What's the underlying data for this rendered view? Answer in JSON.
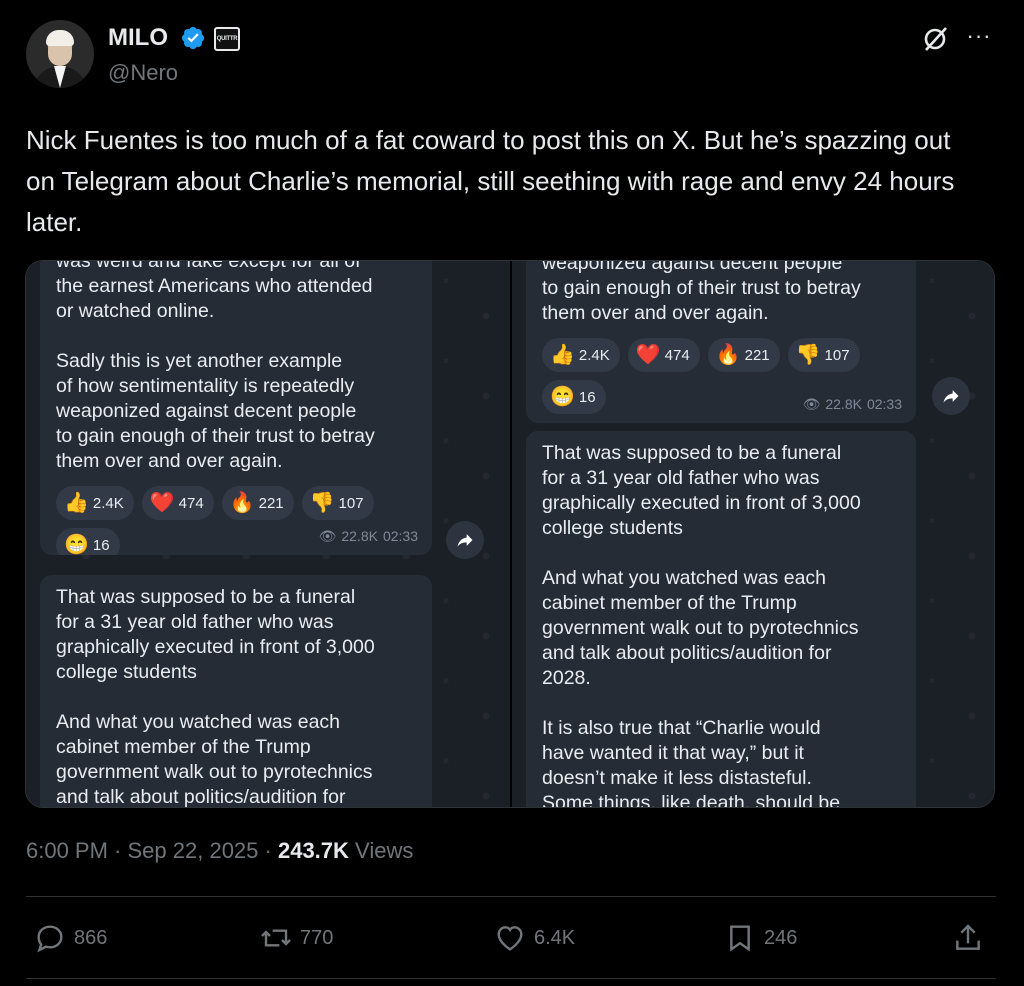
{
  "author": {
    "name": "MILO",
    "handle": "@Nero",
    "affiliate_badge_text": "QUITTR",
    "verified_color": "#1d9bf0"
  },
  "tweet": {
    "text": "Nick Fuentes is too much of a fat coward to post this on X. But he’s spazzing out on Telegram about Charlie’s memorial, still seething with rage and envy 24 hours later."
  },
  "media": {
    "left": {
      "top_text": "was weird and fake except for all of\nthe earnest Americans who attended\nor watched online.\n\nSadly this is yet another example\nof how sentimentality is repeatedly\nweaponized against decent people\nto gain enough of their trust to betray\nthem over and over again.",
      "reactions": [
        {
          "emoji": "👍",
          "count": "2.4K"
        },
        {
          "emoji": "❤️",
          "count": "474"
        },
        {
          "emoji": "🔥",
          "count": "221"
        },
        {
          "emoji": "👎",
          "count": "107"
        },
        {
          "emoji": "😁",
          "count": "16"
        }
      ],
      "views": "22.8K",
      "time": "02:33",
      "bottom_text": "That was supposed to be a funeral\nfor a 31 year old father who was\ngraphically executed in front of 3,000\ncollege students\n\nAnd what you watched was each\ncabinet member of the Trump\ngovernment walk out to pyrotechnics\nand talk about politics/audition for"
    },
    "right": {
      "top_text": "weaponized against decent people\nto gain enough of their trust to betray\nthem over and over again.",
      "reactions": [
        {
          "emoji": "👍",
          "count": "2.4K"
        },
        {
          "emoji": "❤️",
          "count": "474"
        },
        {
          "emoji": "🔥",
          "count": "221"
        },
        {
          "emoji": "👎",
          "count": "107"
        },
        {
          "emoji": "😁",
          "count": "16"
        }
      ],
      "views": "22.8K",
      "time": "02:33",
      "bottom_text": "That was supposed to be a funeral\nfor a 31 year old father who was\ngraphically executed in front of 3,000\ncollege students\n\nAnd what you watched was each\ncabinet member of the Trump\ngovernment walk out to pyrotechnics\nand talk about politics/audition for\n2028.\n\nIt is also true that “Charlie would\nhave wanted it that way,” but it\ndoesn’t make it less distasteful.\nSome things, like death, should be"
    }
  },
  "footer": {
    "time": "6:00 PM",
    "date": "Sep 22, 2025",
    "views_count": "243.7K",
    "views_label": "Views"
  },
  "actions": {
    "replies": "866",
    "reposts": "770",
    "likes": "6.4K",
    "bookmarks": "246"
  }
}
